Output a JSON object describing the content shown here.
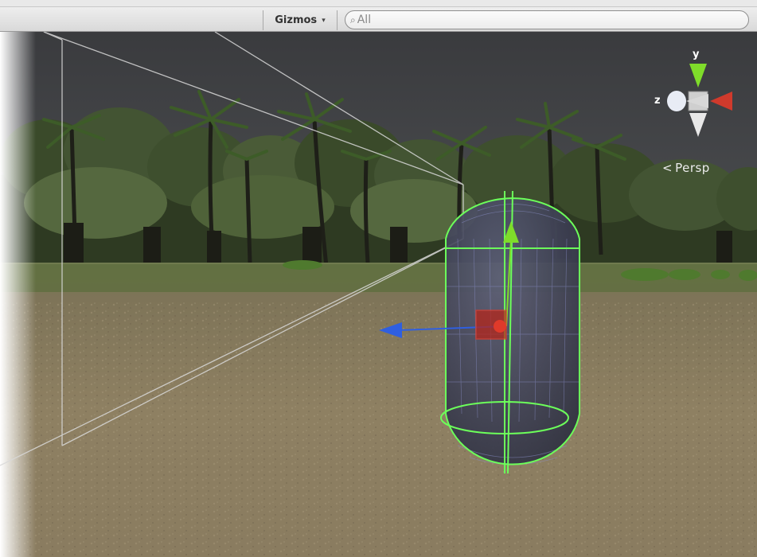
{
  "toolbar": {
    "gizmos_label": "Gizmos",
    "gizmos_arrow": "▾",
    "search_icon": "⌕",
    "search_value": "All"
  },
  "scene_gizmo": {
    "y_axis_label": "y",
    "z_axis_label": "z",
    "projection_label": "Persp",
    "projection_marker": "<"
  },
  "colors": {
    "y_axis": "#7fdc2a",
    "x_axis": "#e03a2a",
    "z_axis": "#2f5fe0",
    "collider": "#6cff5a",
    "sky": "#3b3c3f",
    "ground": "#8a7a5c"
  },
  "icons": [
    "search-icon",
    "dropdown-arrow-icon",
    "scene-orientation-gizmo",
    "move-handle"
  ]
}
